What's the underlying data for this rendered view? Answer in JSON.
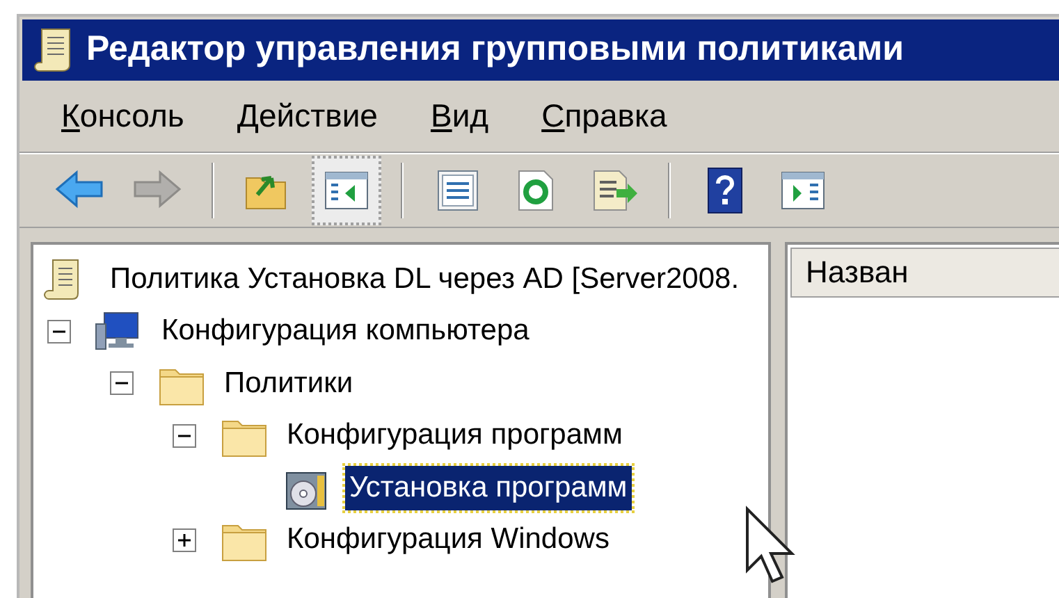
{
  "window": {
    "title": "Редактор управления групповыми политиками"
  },
  "menu": [
    {
      "label": "Консоль"
    },
    {
      "label": "Действие"
    },
    {
      "label": "Вид"
    },
    {
      "label": "Справка"
    }
  ],
  "toolbar": [
    {
      "kind": "back",
      "disabled": false,
      "pressed": false
    },
    {
      "kind": "forward",
      "disabled": true,
      "pressed": false
    },
    {
      "kind": "separator"
    },
    {
      "kind": "up",
      "disabled": false,
      "pressed": false
    },
    {
      "kind": "tree",
      "disabled": false,
      "pressed": true
    },
    {
      "kind": "separator"
    },
    {
      "kind": "properties",
      "disabled": false,
      "pressed": false
    },
    {
      "kind": "refresh",
      "disabled": false,
      "pressed": false
    },
    {
      "kind": "export",
      "disabled": false,
      "pressed": false
    },
    {
      "kind": "separator"
    },
    {
      "kind": "help",
      "disabled": false,
      "pressed": false
    },
    {
      "kind": "pane",
      "disabled": false,
      "pressed": false
    }
  ],
  "tree": [
    {
      "kind": "gpo",
      "label": "Политика Установка DL через AD [Server2008.",
      "selected": false,
      "children": [
        {
          "kind": "computer",
          "label": "Конфигурация компьютера",
          "expanded": true,
          "selected": false,
          "children": [
            {
              "kind": "folder",
              "label": "Политики",
              "expanded": true,
              "selected": false,
              "children": [
                {
                  "kind": "folder",
                  "label": "Конфигурация программ",
                  "expanded": true,
                  "selected": false,
                  "children": [
                    {
                      "kind": "software",
                      "label": "Установка программ",
                      "selected": true
                    }
                  ]
                },
                {
                  "kind": "folder",
                  "label": "Конфигурация Windows",
                  "expanded": false,
                  "selected": false
                }
              ]
            }
          ]
        }
      ]
    }
  ],
  "list": {
    "columns": [
      {
        "label": "Назван"
      }
    ]
  }
}
